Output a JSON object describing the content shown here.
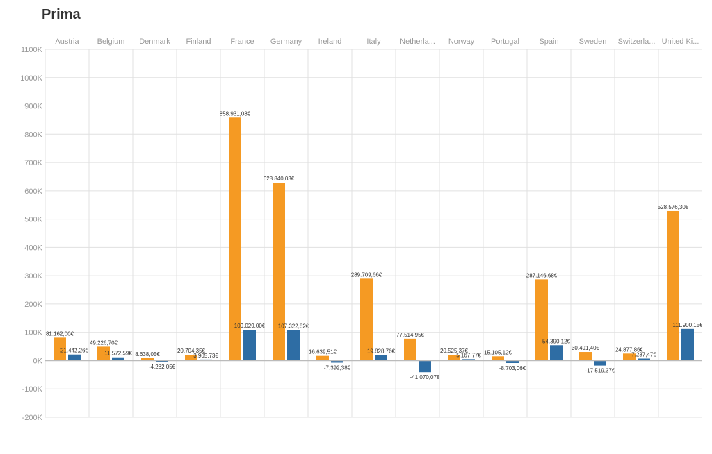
{
  "title": "Prima",
  "colors": {
    "orange": "#f59a23",
    "blue": "#2e6da4",
    "grid": "#e0e0e0",
    "axis_text": "#888888",
    "bar_label": "#333333"
  },
  "y_axis": {
    "labels": [
      "1100K",
      "1000K",
      "900K",
      "800K",
      "700K",
      "600K",
      "500K",
      "400K",
      "300K",
      "200K",
      "100K",
      "0K",
      "-100K",
      "-200K"
    ],
    "min": -200000,
    "max": 1100000,
    "zero_pct": 0.153846
  },
  "countries": [
    {
      "name": "Austria",
      "orange": 81162.0,
      "blue": 21442.26
    },
    {
      "name": "Belgium",
      "orange": 49226.7,
      "blue": 11572.59
    },
    {
      "name": "Denmark",
      "orange": 8638.05,
      "blue": -4282.05
    },
    {
      "name": "Finland",
      "orange": 20704.35,
      "blue": 3905.73
    },
    {
      "name": "France",
      "orange": 858931.08,
      "blue": 109029.0
    },
    {
      "name": "Germany",
      "orange": 628840.03,
      "blue": 107322.82
    },
    {
      "name": "Ireland",
      "orange": 16639.51,
      "blue": -7392.38
    },
    {
      "name": "Italy",
      "orange": 289709.66,
      "blue": 19828.76
    },
    {
      "name": "Netherla...",
      "orange": 77514.95,
      "blue": -41070.07
    },
    {
      "name": "Norway",
      "orange": 20525.37,
      "blue": 5167.77
    },
    {
      "name": "Portugal",
      "orange": 15105.12,
      "blue": -8703.06
    },
    {
      "name": "Spain",
      "orange": 287146.68,
      "blue": 54390.12
    },
    {
      "name": "Sweden",
      "orange": 30491.4,
      "blue": -17519.37
    },
    {
      "name": "Switzerla...",
      "orange": 24877.86,
      "blue": 7237.47
    },
    {
      "name": "United Ki...",
      "orange": 528576.3,
      "blue": 111900.15
    }
  ]
}
